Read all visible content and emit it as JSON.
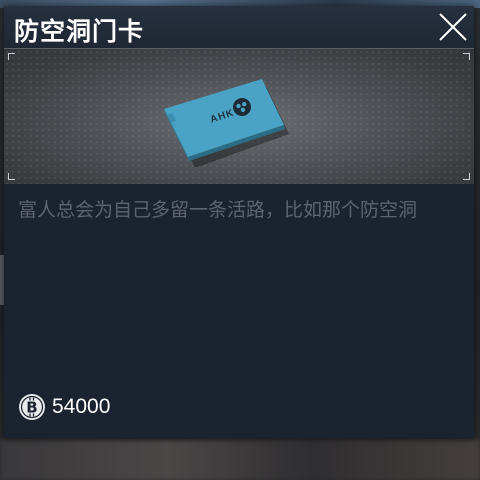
{
  "dialog": {
    "title": "防空洞门卡",
    "close_icon": "close-icon"
  },
  "item": {
    "card_label": "AHK",
    "card_color": "#4aa3c4",
    "description": "富人总会为自己多留一条活路，比如那个防空洞"
  },
  "price": {
    "currency_icon": "bitcoin-coin-icon",
    "amount": "54000"
  },
  "colors": {
    "panel_bg": "#1b2230",
    "description_text": "#5d6470",
    "title_text": "#ffffff"
  }
}
